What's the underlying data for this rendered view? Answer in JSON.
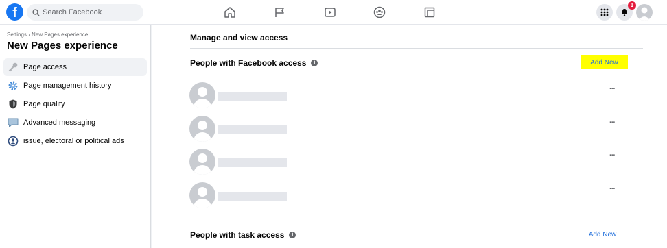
{
  "topbar": {
    "logo": "f",
    "search_placeholder": "Search Facebook",
    "nav_icons": [
      "home-icon",
      "pages-flag-icon",
      "watch-video-icon",
      "groups-icon",
      "gaming-icon"
    ],
    "notification_count": "1"
  },
  "sidebar": {
    "breadcrumb": "Settings › New Pages experience",
    "title": "New Pages experience",
    "items": [
      {
        "label": "Page access",
        "icon": "key-icon",
        "active": true
      },
      {
        "label": "Page management history",
        "icon": "gear-icon"
      },
      {
        "label": "Page quality",
        "icon": "shield-icon"
      },
      {
        "label": "Advanced messaging",
        "icon": "chat-bubble-icon"
      },
      {
        "label": "issue, electoral or political ads",
        "icon": "person-circle-icon"
      }
    ]
  },
  "main": {
    "section_title": "Manage and view access",
    "facebook_access": {
      "title": "People with Facebook access",
      "add_new": "Add New"
    },
    "people_count": 4,
    "task_access": {
      "title": "People with task access",
      "add_new": "Add New"
    },
    "more_label": "···"
  },
  "colors": {
    "brand": "#1877f2",
    "link": "#216fdb",
    "highlight": "#ffff00",
    "badge": "#e41e3f"
  }
}
